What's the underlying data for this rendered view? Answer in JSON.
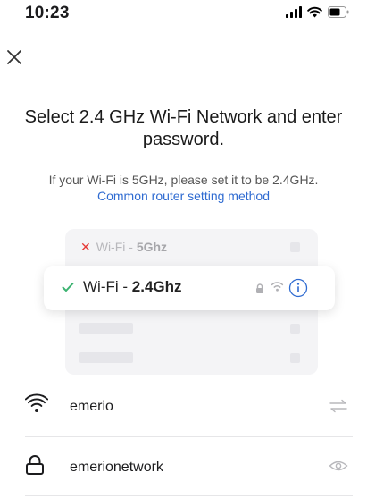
{
  "status_bar": {
    "time": "10:23",
    "icons": [
      "signal-icon",
      "wifi-icon",
      "battery-icon"
    ]
  },
  "header": {
    "close_icon": "close-icon",
    "title": "Select 2.4 GHz Wi-Fi Network and enter password.",
    "hint": "If your Wi-Fi is 5GHz, please set it to be 2.4GHz.",
    "link": "Common router setting method"
  },
  "illustration": {
    "bad_prefix": "Wi-Fi - ",
    "bad_band": "5Ghz",
    "good_prefix": "Wi-Fi - ",
    "good_band": "2.4Ghz"
  },
  "form": {
    "ssid_value": "emerio",
    "password_value": "emerionetwork"
  },
  "colors": {
    "accent": "#2f6bd1",
    "check": "#3cb371",
    "error": "#e53935"
  }
}
